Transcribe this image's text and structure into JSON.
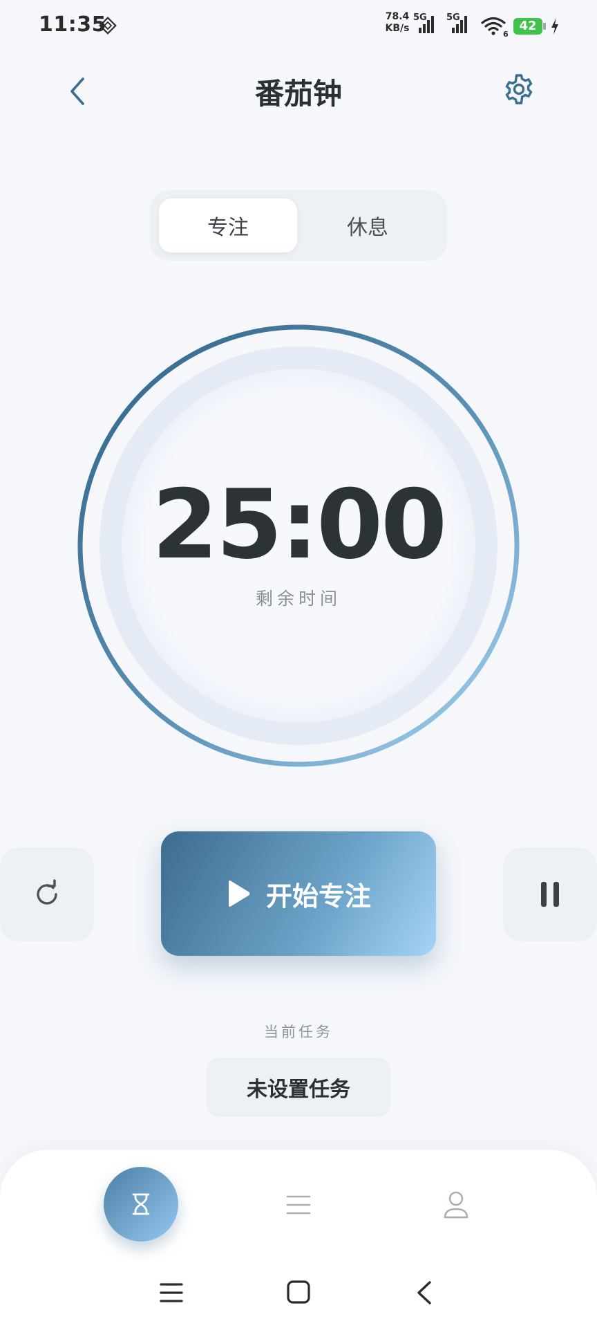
{
  "status_bar": {
    "time": "11:35",
    "net_speed_value": "78.4",
    "net_speed_unit": "KB/s",
    "sim1_label": "5G",
    "sim2_label": "5G",
    "wifi_badge": "6",
    "battery_level": "42"
  },
  "header": {
    "title": "番茄钟"
  },
  "mode_tabs": [
    {
      "label": "专注",
      "active": true
    },
    {
      "label": "休息",
      "active": false
    }
  ],
  "timer": {
    "value": "25:00",
    "label": "剩余时间",
    "progress_fraction": 1.0
  },
  "controls": {
    "start_label": "开始专注"
  },
  "task": {
    "caption": "当前任务",
    "value": "未设置任务"
  },
  "colors": {
    "accent_dark": "#3c6c8e",
    "accent_light": "#a4d4f7",
    "ring_track": "#e3eaf4",
    "background": "#f5f7fa"
  },
  "icons": {
    "back": "chevron-left-icon",
    "settings": "gear-icon",
    "reset": "refresh-icon",
    "play": "play-icon",
    "pause": "pause-icon",
    "tab_timer": "hourglass-icon",
    "tab_list": "list-icon",
    "tab_profile": "person-icon"
  }
}
